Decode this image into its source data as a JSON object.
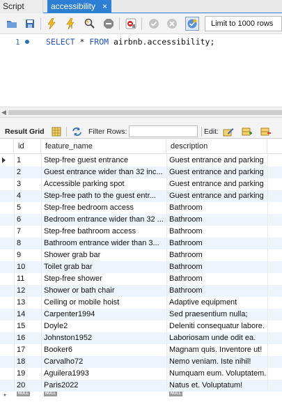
{
  "tabs": [
    {
      "label": "Script"
    },
    {
      "label": "accessibility",
      "close": "×"
    }
  ],
  "toolbar": {
    "limit_label": "Limit to 1000 rows"
  },
  "editor": {
    "line_number": "1",
    "kw_select": "SELECT",
    "star": "*",
    "kw_from": "FROM",
    "table": "airbnb.accessibility;"
  },
  "result_toolbar": {
    "result_grid_label": "Result Grid",
    "filter_label": "Filter Rows:",
    "filter_value": "",
    "edit_label": "Edit:"
  },
  "grid": {
    "columns": [
      "id",
      "feature_name",
      "description"
    ],
    "rows": [
      [
        "1",
        "Step-free guest entrance",
        "Guest entrance and parking"
      ],
      [
        "2",
        "Guest entrance wider than 32 inc...",
        "Guest entrance and parking"
      ],
      [
        "3",
        "Accessible parking spot",
        "Guest entrance and parking"
      ],
      [
        "4",
        "Step-free path to the guest entr...",
        "Guest entrance and parking"
      ],
      [
        "5",
        "Step-free bedroom access",
        "Bathroom"
      ],
      [
        "6",
        "Bedroom entrance wider than 32 ...",
        "Bathroom"
      ],
      [
        "7",
        "Step-free bathroom access",
        "Bathroom"
      ],
      [
        "8",
        "Bathroom entrance wider than 3...",
        "Bathroom"
      ],
      [
        "9",
        "Shower grab bar",
        "Bathroom"
      ],
      [
        "10",
        "Toilet grab bar",
        "Bathroom"
      ],
      [
        "11",
        "Step-free shower",
        "Bathroom"
      ],
      [
        "12",
        "Shower or bath chair",
        "Bathroom"
      ],
      [
        "13",
        "Ceiling or mobile hoist",
        "Adaptive equipment"
      ],
      [
        "14",
        "Carpenter1994",
        "Sed praesentium nulla;"
      ],
      [
        "15",
        "Doyle2",
        "Deleniti consequatur labore."
      ],
      [
        "16",
        "Johnston1952",
        "Laboriosam unde odit ea."
      ],
      [
        "17",
        "Booker6",
        "Magnam quis. Inventore ut!"
      ],
      [
        "18",
        "Carvalho72",
        "Nemo veniam. Iste nihil!"
      ],
      [
        "19",
        "Aguilera1993",
        "Numquam eum. Voluptatem."
      ],
      [
        "20",
        "Paris2022",
        "Natus et. Voluptatum!"
      ]
    ],
    "new_row_marker": "*",
    "null_label": "NULL"
  },
  "colors": {
    "tab_active": "#2d7fd3",
    "row_alt": "#eef4fb",
    "keyword": "#2255cc"
  },
  "icons": [
    "folder-icon",
    "save-icon",
    "execute-icon",
    "execute-current-icon",
    "explain-icon",
    "stop-icon",
    "toggle-continue-icon",
    "commit-icon",
    "rollback-icon",
    "autocommit-icon",
    "grid-icon",
    "refresh-icon",
    "edit-cell-icon",
    "add-row-icon",
    "delete-row-icon"
  ]
}
